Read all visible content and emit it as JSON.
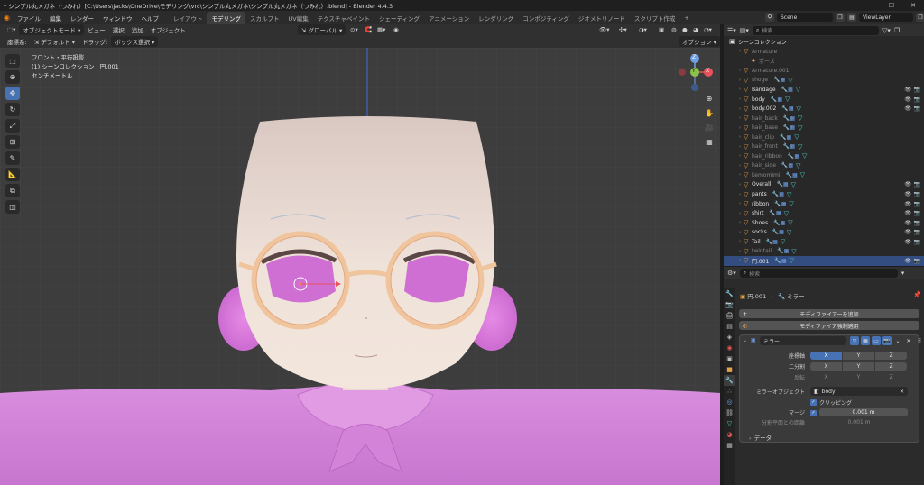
{
  "window": {
    "title": "* シンプル丸メガネ（つみれ）[C:\\Users\\jacks\\OneDrive\\モデリング\\vrc\\シンプル丸メガネ\\シンプル丸メガネ（つみれ）.blend] - Blender 4.4.3",
    "min": "─",
    "max": "☐",
    "close": "✕"
  },
  "menu": [
    "ファイル",
    "編集",
    "レンダー",
    "ウィンドウ",
    "ヘルプ"
  ],
  "workspaces": [
    "レイアウト",
    "モデリング",
    "スカルプト",
    "UV編集",
    "テクスチャペイント",
    "シェーディング",
    "アニメーション",
    "レンダリング",
    "コンポジティング",
    "ジオメトリノード",
    "スクリプト作成"
  ],
  "active_workspace": "モデリング",
  "scene": "Scene",
  "view_layer": "ViewLayer",
  "vp_header1": {
    "mode": "オブジェクトモード",
    "menus": [
      "ビュー",
      "選択",
      "追加",
      "オブジェクト"
    ],
    "orientation": "グローバル"
  },
  "vp_header2": {
    "coord_label": "座標系:",
    "coord_value": "デフォルト",
    "drag_label": "ドラッグ:",
    "drag_value": "ボックス選択",
    "options": "オプション"
  },
  "overlay": {
    "view_name": "フロント・平行投影",
    "collection_info": "(1) シーンコレクション | 円.001",
    "units": "センチメートル"
  },
  "gizmo": {
    "x": "X",
    "y": "Y",
    "z": "Z"
  },
  "outliner": {
    "search_placeholder": "検索",
    "root": "シーンコレクション",
    "rows": [
      {
        "name": "Armature",
        "dim": true
      },
      {
        "name": "ポーズ",
        "dim": true
      },
      {
        "name": "Armature.001",
        "dim": true
      },
      {
        "name": "shoge",
        "dim": true
      },
      {
        "name": "Bandage",
        "dim": false
      },
      {
        "name": "body",
        "dim": false
      },
      {
        "name": "body.002",
        "dim": false
      },
      {
        "name": "hair_back",
        "dim": true
      },
      {
        "name": "hair_base",
        "dim": true
      },
      {
        "name": "hair_clip",
        "dim": true
      },
      {
        "name": "hair_front",
        "dim": true
      },
      {
        "name": "hair_ribbon",
        "dim": true
      },
      {
        "name": "hair_side",
        "dim": true
      },
      {
        "name": "kemomimi",
        "dim": true
      },
      {
        "name": "Overall",
        "dim": false
      },
      {
        "name": "pants",
        "dim": false
      },
      {
        "name": "ribbon",
        "dim": false
      },
      {
        "name": "shirt",
        "dim": false
      },
      {
        "name": "Shoes",
        "dim": false
      },
      {
        "name": "socks",
        "dim": false
      },
      {
        "name": "Tail",
        "dim": false
      },
      {
        "name": "twintail",
        "dim": true
      },
      {
        "name": "円.001",
        "dim": false,
        "selected": true
      }
    ]
  },
  "properties": {
    "search_placeholder": "検索",
    "breadcrumb_obj": "円.001",
    "breadcrumb_mod": "ミラー",
    "add_modifier": "モディファイアーを追加",
    "apply_all": "モディファイア強制適用",
    "modifier_name": "ミラー",
    "axis_label": "座標軸",
    "bisect_label": "二分割",
    "flip_label": "反転",
    "x": "X",
    "y": "Y",
    "z": "Z",
    "mirror_object_label": "ミラーオブジェクト",
    "mirror_object": "body",
    "clipping": "クリッピング",
    "merge_label": "マージ",
    "merge_value": "0.001 m",
    "bisect_dist_label": "分割平面との距離",
    "bisect_dist_value": "0.001 m",
    "data_panel": "データ"
  },
  "colors": {
    "accent": "#4772b3",
    "object_orange": "#e5a24a",
    "mesh_teal": "#4fd0c7",
    "shirt_pink": "#d47ad8",
    "skin": "#efe0d6"
  }
}
